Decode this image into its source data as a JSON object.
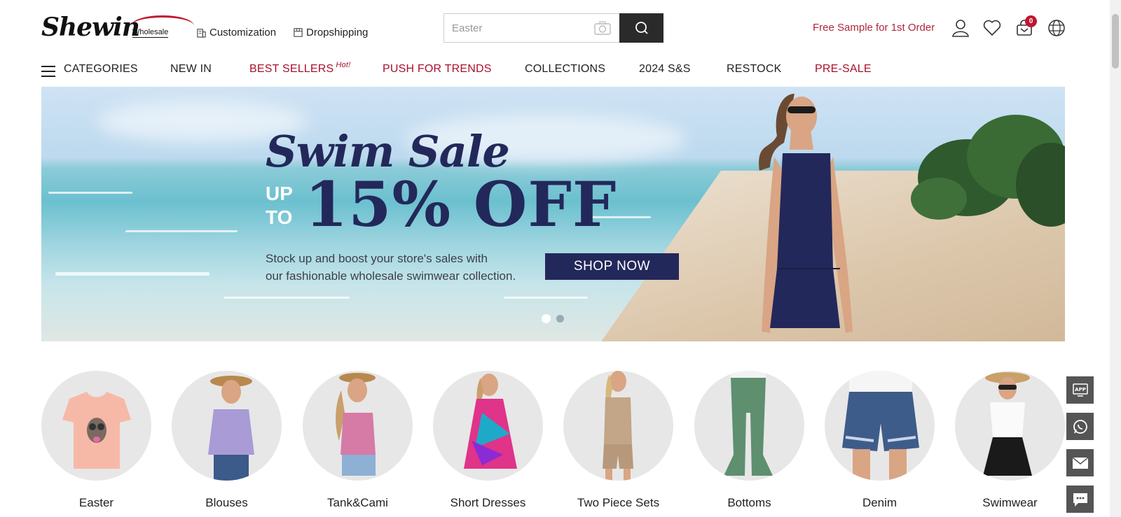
{
  "header": {
    "logo_text": "Shewin",
    "logo_sub": "Wholesale",
    "links": [
      {
        "label": "Customization",
        "icon": "building-icon"
      },
      {
        "label": "Dropshipping",
        "icon": "box-icon"
      }
    ],
    "search": {
      "placeholder": "Easter"
    },
    "free_sample": "Free Sample for 1st Order",
    "cart_count": "0"
  },
  "nav": {
    "categories_label": "CATEGORIES",
    "items": [
      {
        "label": "NEW IN",
        "color": "#222222"
      },
      {
        "label": "BEST SELLERS",
        "hot": "Hot!",
        "color": "#a8102c"
      },
      {
        "label": "PUSH FOR TRENDS",
        "color": "#a8102c"
      },
      {
        "label": "COLLECTIONS",
        "color": "#222222"
      },
      {
        "label": "2024 S&S",
        "color": "#222222"
      },
      {
        "label": "RESTOCK",
        "color": "#222222"
      },
      {
        "label": "PRE-SALE",
        "color": "#a8102c"
      }
    ]
  },
  "banner": {
    "title": "Swim Sale",
    "up": "UP",
    "to": "TO",
    "discount": "15% OFF",
    "desc_line1": "Stock up and boost your store's sales with",
    "desc_line2": "our fashionable wholesale swimwear collection.",
    "cta": "SHOP NOW",
    "slides": 2,
    "active_slide": 1
  },
  "categories": [
    {
      "label": "Easter"
    },
    {
      "label": "Blouses"
    },
    {
      "label": "Tank&Cami"
    },
    {
      "label": "Short Dresses"
    },
    {
      "label": "Two Piece Sets"
    },
    {
      "label": "Bottoms"
    },
    {
      "label": "Denim"
    },
    {
      "label": "Swimwear"
    }
  ],
  "side_buttons": [
    {
      "icon": "app-icon"
    },
    {
      "icon": "whatsapp-icon"
    },
    {
      "icon": "mail-icon"
    },
    {
      "icon": "chat-icon"
    }
  ],
  "colors": {
    "brand_red": "#a8102c",
    "navy": "#23285a"
  }
}
